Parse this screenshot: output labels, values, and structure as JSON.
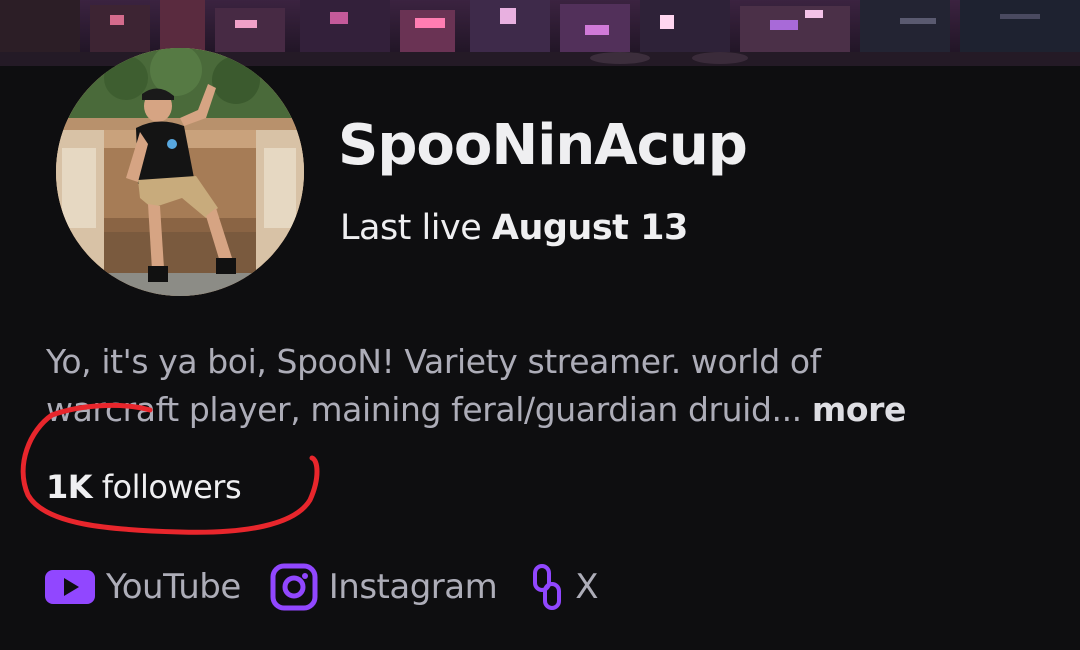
{
  "channel": {
    "name": "SpooNinAcup",
    "last_live_label": "Last live",
    "last_live_date": "August 13"
  },
  "bio": {
    "line1": "Yo, it's ya boi, SpooN! Variety streamer. world of",
    "line2": "warcraft player, maining feral/guardian druid...",
    "more_label": "more"
  },
  "followers": {
    "count": "1K",
    "label": "followers"
  },
  "social_links": [
    {
      "label": "YouTube",
      "icon": "youtube-icon"
    },
    {
      "label": "Instagram",
      "icon": "instagram-icon"
    },
    {
      "label": "X",
      "icon": "link-icon"
    }
  ],
  "colors": {
    "background": "#0e0e10",
    "accent": "#9147ff",
    "muted_text": "#adadb8",
    "annotation": "#e8262c"
  }
}
